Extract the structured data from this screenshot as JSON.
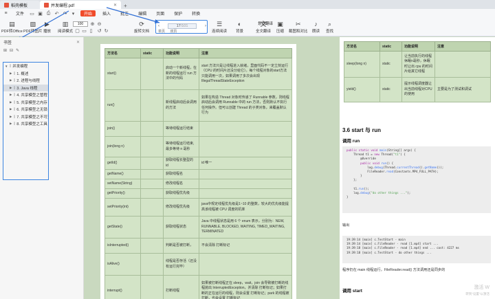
{
  "tabs": [
    {
      "label": "稻壳模板",
      "active": false
    },
    {
      "label": "并发编程.pdf",
      "active": true
    }
  ],
  "menu": {
    "items": [
      "文件",
      "开始",
      "插入",
      "批注",
      "编辑",
      "页面",
      "保护",
      "转换"
    ],
    "active": "开始"
  },
  "ribbon": {
    "buttons_left": [
      "PDF转Office",
      "PDF转图片",
      "播放",
      "阅读模式"
    ],
    "zoom": "100",
    "rotate": "旋转文档",
    "page_current": "17",
    "page_total": "/101",
    "single_page": "单页",
    "double_page": "双页",
    "continuous": "连续阅读",
    "auto_scroll": "自动滚动",
    "background": "背景",
    "translate_full": "全文翻译",
    "translate_word": "划词翻译",
    "compress": "压缩",
    "screenshot_compare": "截图和对比",
    "read_aloud": "朗读",
    "find": "查找"
  },
  "sidebar": {
    "title": "书签",
    "toc": [
      {
        "label": "并发编程",
        "level": 0
      },
      {
        "label": "1. 概述",
        "level": 1
      },
      {
        "label": "2. 进程与线程",
        "level": 1
      },
      {
        "label": "3. Java 线程",
        "level": 1,
        "selected": true
      },
      {
        "label": "4. 共享模型之管程",
        "level": 1
      },
      {
        "label": "5. 共享模型之内存",
        "level": 1
      },
      {
        "label": "6. 共享模型之无锁",
        "level": 1
      },
      {
        "label": "7. 共享模型之不可变",
        "level": 1
      },
      {
        "label": "8. 共享模型之工具",
        "level": 1
      }
    ]
  },
  "left_table": {
    "headers": [
      "方法名",
      "static",
      "功能说明",
      "注意"
    ],
    "rows": [
      [
        "start()",
        "",
        "启动一个新线程，在新的线程运行 run 方法中的代码",
        "start 方法只是让线程进入就绪，里面代码不一定立刻运行（CPU 的时间片还没分给它）。每个线程对象的start方法只能调用一次，如果调用了多次会出现IllegalThreadStateException"
      ],
      [
        "run()",
        "",
        "新线程启动后会调用的方法",
        "如果在构造 Thread 对象时传递了 Runnable 参数，则线程启动后会调用 Runnable 中的 run 方法，否则默认不执行任何操作。但可以创建 Thread 的子类对象，来覆盖默认行为"
      ],
      [
        "join()",
        "",
        "等待线程运行结束",
        ""
      ],
      [
        "join(long n)",
        "",
        "等待线程运行结束,最多等待 n 毫秒",
        ""
      ],
      [
        "getId()",
        "",
        "获取线程长整型的 id",
        "id 唯一"
      ],
      [
        "getName()",
        "",
        "获取线程名",
        ""
      ],
      [
        "setName(String)",
        "",
        "修改线程名",
        ""
      ],
      [
        "getPriority()",
        "",
        "获取线程优先级",
        ""
      ],
      [
        "setPriority(int)",
        "",
        "修改线程优先级",
        "java中规定线程优先级是1~10 的整数，较大的优先级能提高该线程被 CPU 调度的机率"
      ],
      [
        "getState()",
        "",
        "获取线程状态",
        "Java 中线程状态是用 6 个 enum 表示，分别为：NEW, RUNNABLE, BLOCKED, WAITING, TIMED_WAITING, TERMINATED"
      ],
      [
        "isInterrupted()",
        "",
        "判断是否被打断，",
        "不会清除 打断标记"
      ],
      [
        "isAlive()",
        "",
        "线程是否存活（还没有运行完毕）",
        ""
      ],
      [
        "interrupt()",
        "",
        "打断线程",
        "如果被打断线程正在 sleep，wait，join 会导致被打断的线程抛出 InterruptedException，并清除 打断标记；如果打断的正在运行的线程，则会设置 打断标记；park 的线程被打断，也会设置 打断标记"
      ]
    ]
  },
  "right_table": {
    "headers": [
      "方法名",
      "static",
      "功能说明",
      "注意"
    ],
    "rows": [
      [
        "sleep(long n)",
        "static",
        "让当前执行的线程休眠n毫秒，休眠时让出 cpu 的时间片给其它线程",
        ""
      ],
      [
        "yield()",
        "static",
        "提示线程调度器让出当前线程对CPU的使用",
        "主要是为了测试和调试"
      ]
    ]
  },
  "right_page": {
    "section_title": "3.6 start 与 run",
    "subtitle_run": "调用 run",
    "code_lines": [
      "public static void main(String[] args) {",
      "    Thread t1 = new Thread(\"t1\") {",
      "        @Override",
      "        public void run() {",
      "            log.debug(Thread.currentThread().getName());",
      "            FileReader.read(Constants.MP4_FULL_PATH);",
      "        }",
      "    };",
      "",
      "    t1.run();",
      "    log.debug(\"do other things ...\");",
      "}"
    ],
    "output_label": "输出",
    "output_lines": [
      "19:39:14 [main] c.TestStart - main",
      "19:39:14 [main] c.FileReader - read [1.mp4] start ...",
      "19:39:18 [main] c.FileReader - read [1.mp4] end ... cost: 4227 ms",
      "19:39:18 [main] c.TestStart - do other things ..."
    ],
    "note": "程序仍在 main 线程运行，FileReader.read() 方法调用还是同步的",
    "subtitle_start": "调用 start",
    "watermark": "激活 W",
    "watermark_sub": "转到\"设置\"以激活"
  }
}
